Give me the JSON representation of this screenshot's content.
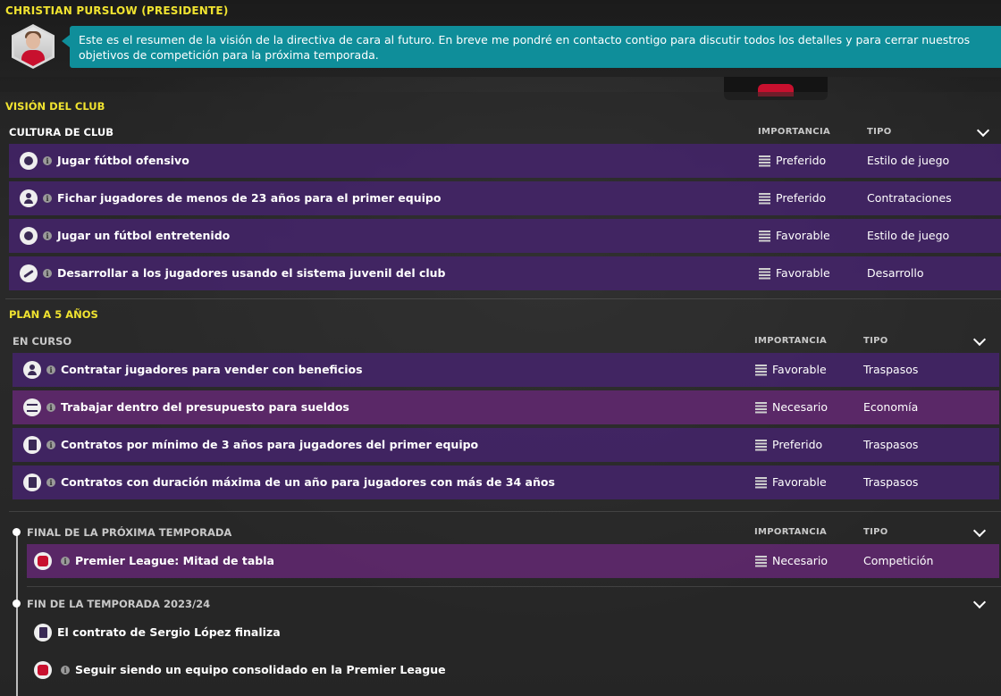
{
  "header": {
    "president_name": "CHRISTIAN PURSLOW (PRESIDENTE)",
    "message": "Este es el resumen de la visión de la directiva de cara al futuro. En breve me pondré en contacto contigo para discutir todos los detalles y para cerrar nuestros objetivos de competición para la próxima temporada."
  },
  "vision": {
    "title": "VISIÓN DEL CLUB",
    "culture": {
      "title": "CULTURA DE CLUB",
      "col_importance": "IMPORTANCIA",
      "col_type": "TIPO",
      "rows": [
        {
          "label": "Jugar fútbol ofensivo",
          "importance": "Preferido",
          "type": "Estilo de juego",
          "icon": "ball-icon"
        },
        {
          "label": "Fichar jugadores de menos de 23 años para el primer equipo",
          "importance": "Preferido",
          "type": "Contrataciones",
          "icon": "person-icon"
        },
        {
          "label": "Jugar un fútbol entretenido",
          "importance": "Favorable",
          "type": "Estilo de juego",
          "icon": "ball-icon"
        },
        {
          "label": "Desarrollar a los jugadores usando el sistema juvenil del club",
          "importance": "Favorable",
          "type": "Desarrollo",
          "icon": "whistle-icon"
        }
      ]
    }
  },
  "plan": {
    "title": "PLAN A 5 AÑOS",
    "ongoing": {
      "title": "EN CURSO",
      "col_importance": "IMPORTANCIA",
      "col_type": "TIPO",
      "rows": [
        {
          "label": "Contratar jugadores para vender con beneficios",
          "importance": "Favorable",
          "type": "Traspasos",
          "icon": "person-icon"
        },
        {
          "label": "Trabajar dentro del presupuesto para sueldos",
          "importance": "Necesario",
          "type": "Economía",
          "icon": "money-icon"
        },
        {
          "label": "Contratos por mínimo de 3 años para jugadores del primer equipo",
          "importance": "Preferido",
          "type": "Traspasos",
          "icon": "contract-icon"
        },
        {
          "label": "Contratos con duración máxima de un año para jugadores con más de 34 años",
          "importance": "Favorable",
          "type": "Traspasos",
          "icon": "contract-icon"
        }
      ]
    },
    "next_season": {
      "title": "FINAL DE LA PRÓXIMA TEMPORADA",
      "col_importance": "IMPORTANCIA",
      "col_type": "TIPO",
      "rows": [
        {
          "label": "Premier League: Mitad de tabla",
          "importance": "Necesario",
          "type": "Competición",
          "icon": "premier-league-icon"
        }
      ]
    },
    "season_end": {
      "title": "FIN DE LA TEMPORADA 2023/24",
      "rows": [
        {
          "label": "El contrato de Sergio López finaliza",
          "icon": "contract-icon"
        },
        {
          "label": "Seguir siendo un equipo consolidado en la Premier League",
          "icon": "premier-league-icon"
        }
      ]
    }
  }
}
